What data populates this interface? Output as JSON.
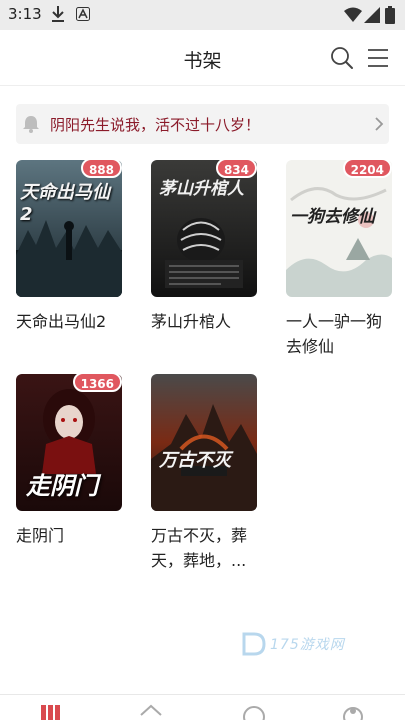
{
  "status_bar": {
    "time": "3:13"
  },
  "header": {
    "title": "书架"
  },
  "notice": {
    "text": "阴阳先生说我，活不过十八岁！"
  },
  "books": [
    {
      "title": "天命出马仙2",
      "badge": "888",
      "cover_text": "天命出马仙2"
    },
    {
      "title": "茅山升棺人",
      "badge": "834",
      "cover_text": "茅山升棺人"
    },
    {
      "title": "一人一驴一狗去修仙",
      "badge": "2204",
      "cover_text": "一狗去修仙"
    },
    {
      "title": "走阴门",
      "badge": "1366",
      "cover_text": "走阴门"
    },
    {
      "title": "万古不灭，葬天，葬地，...",
      "badge": "",
      "cover_text": "万古不灭"
    }
  ],
  "watermark": {
    "text": "175游戏网"
  },
  "colors": {
    "badge": "#e0575f",
    "notice_text": "#8b1b2a",
    "nav_active": "#d94a4f"
  }
}
